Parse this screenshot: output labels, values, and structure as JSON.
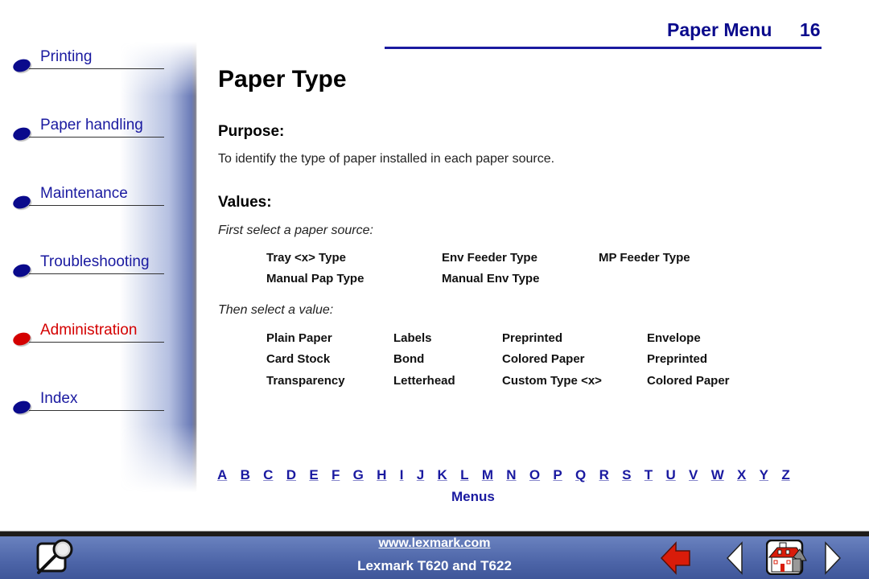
{
  "sidebar": {
    "items": [
      {
        "label": "Printing",
        "active": false
      },
      {
        "label": "Paper handling",
        "active": false
      },
      {
        "label": "Maintenance",
        "active": false
      },
      {
        "label": "Troubleshooting",
        "active": false
      },
      {
        "label": "Administration",
        "active": true
      },
      {
        "label": "Index",
        "active": false
      }
    ]
  },
  "header": {
    "section": "Paper Menu",
    "page_number": "16"
  },
  "main": {
    "title": "Paper Type",
    "purpose_heading": "Purpose:",
    "purpose_text": "To identify the type of paper installed in each paper source.",
    "values_heading": "Values:",
    "source_prompt": "First select a paper source:",
    "sources": [
      [
        "Tray <x> Type",
        "Env Feeder Type",
        "MP Feeder Type"
      ],
      [
        "Manual Pap Type",
        "Manual Env Type"
      ]
    ],
    "value_prompt": "Then select a value:",
    "values": [
      [
        "Plain Paper",
        "Labels",
        "Preprinted",
        "Envelope"
      ],
      [
        "Card Stock",
        "Bond",
        "Colored Paper",
        "Preprinted"
      ],
      [
        "Transparency",
        "Letterhead",
        "Custom Type <x>",
        "Colored Paper"
      ]
    ]
  },
  "alphabet": [
    "A",
    "B",
    "C",
    "D",
    "E",
    "F",
    "G",
    "H",
    "I",
    "J",
    "K",
    "L",
    "M",
    "N",
    "O",
    "P",
    "Q",
    "R",
    "S",
    "T",
    "U",
    "V",
    "W",
    "X",
    "Y",
    "Z"
  ],
  "menus_link": "Menus",
  "footer": {
    "url": "www.lexmark.com",
    "model": "Lexmark T620 and T622",
    "icons": [
      "search-icon",
      "back-arrow-icon",
      "previous-page-icon",
      "home-icon",
      "next-page-icon"
    ]
  },
  "colors": {
    "link_blue": "#1a1aa0",
    "active_red": "#d40000",
    "footer_blue": "#4d65a8"
  }
}
